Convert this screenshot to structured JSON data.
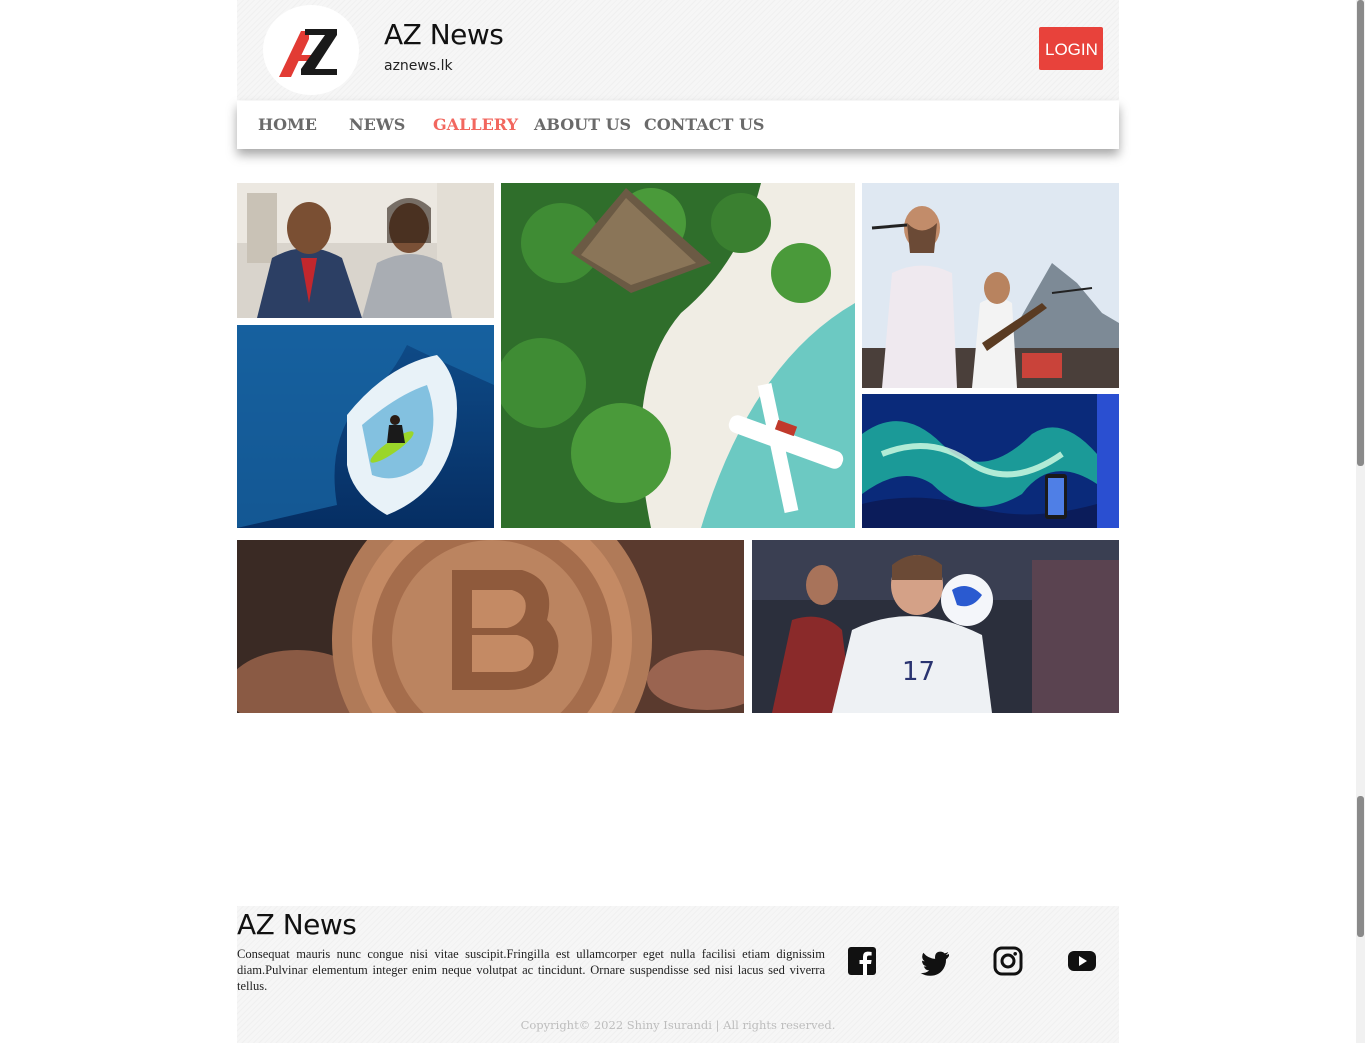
{
  "header": {
    "title": "AZ News",
    "domain": "aznews.lk",
    "login_label": "LOGIN",
    "logo_icon": "az-logo-icon"
  },
  "nav": {
    "items": [
      {
        "label": "HOME",
        "active": false
      },
      {
        "label": "NEWS",
        "active": false
      },
      {
        "label": "GALLERY",
        "active": true
      },
      {
        "label": "ABOUT US",
        "active": false
      },
      {
        "label": "CONTACT US",
        "active": false
      }
    ]
  },
  "gallery": {
    "images": [
      {
        "name": "business-couple-photo"
      },
      {
        "name": "surfer-wave-photo"
      },
      {
        "name": "tropical-island-seaplane-photo"
      },
      {
        "name": "concert-band-photo"
      },
      {
        "name": "monitor-abstract-art-photo"
      },
      {
        "name": "bitcoin-coin-photo"
      },
      {
        "name": "football-player-photo"
      }
    ]
  },
  "footer": {
    "title": "AZ News",
    "description": "Consequat mauris nunc congue nisi vitae suscipit.Fringilla est ullamcorper eget nulla facilisi etiam dignissim diam.Pulvinar elementum integer enim neque volutpat ac tincidunt. Ornare suspendisse sed nisi lacus sed viverra tellus.",
    "copyright": "Copyright© 2022 Shiny Isurandi | All rights reserved.",
    "social": [
      "facebook-icon",
      "twitter-icon",
      "instagram-icon",
      "youtube-icon"
    ]
  },
  "colors": {
    "accent": "#e8423b",
    "nav_active": "#f2675f",
    "nav_text": "#6a6a6a"
  }
}
